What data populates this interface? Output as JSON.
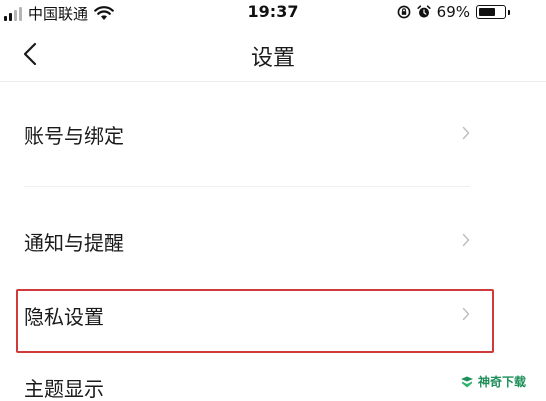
{
  "status_bar": {
    "carrier": "中国联通",
    "time": "19:37",
    "battery": "69%",
    "battery_level": 0.69
  },
  "nav": {
    "title": "设置"
  },
  "menu": [
    {
      "label": "账号与绑定"
    },
    {
      "label": "通知与提醒"
    },
    {
      "label": "隐私设置"
    },
    {
      "label": "主题显示"
    }
  ],
  "watermark": {
    "text": "神奇下载"
  },
  "colors": {
    "highlight": "#cf3a3a",
    "watermark": "#1e8e5a"
  }
}
